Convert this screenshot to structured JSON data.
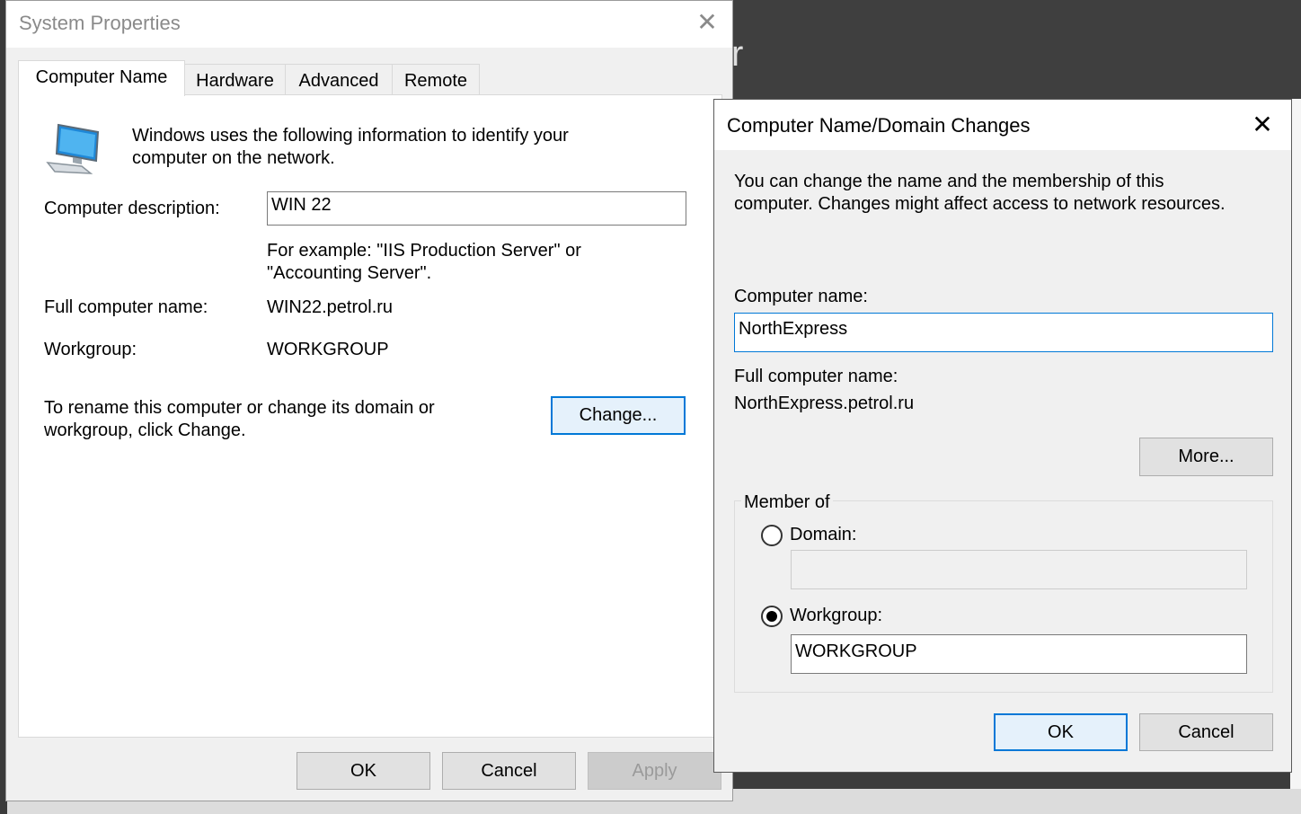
{
  "system_properties": {
    "title": "System Properties",
    "tabs": [
      {
        "label": "Computer Name",
        "active": true
      },
      {
        "label": "Hardware"
      },
      {
        "label": "Advanced"
      },
      {
        "label": "Remote"
      }
    ],
    "intro_line1": "Windows uses the following information to identify your",
    "intro_line2": "computer on the network.",
    "description_label": "Computer description:",
    "description_value": "WIN 22",
    "example_line1": "For example: \"IIS Production Server\" or",
    "example_line2": "\"Accounting Server\".",
    "full_name_label": "Full computer name:",
    "full_name_value": "WIN22.petrol.ru",
    "workgroup_label": "Workgroup:",
    "workgroup_value": "WORKGROUP",
    "rename_line1": "To rename this computer or change its domain or",
    "rename_line2": "workgroup, click Change.",
    "change_button": "Change...",
    "ok_button": "OK",
    "cancel_button": "Cancel",
    "apply_button": "Apply"
  },
  "domain_changes": {
    "title": "Computer Name/Domain Changes",
    "intro_line1": "You can change the name and the membership of this",
    "intro_line2": "computer. Changes might affect access to network resources.",
    "computer_name_label": "Computer name:",
    "computer_name_value": "NorthExpress",
    "full_name_label": "Full computer name:",
    "full_name_value": "NorthExpress.petrol.ru",
    "more_button": "More...",
    "member_of_label": "Member of",
    "domain_label": "Domain:",
    "domain_value": "",
    "domain_selected": false,
    "workgroup_label": "Workgroup:",
    "workgroup_value": "WORKGROUP",
    "workgroup_selected": true,
    "ok_button": "OK",
    "cancel_button": "Cancel"
  },
  "background": {
    "letter": "r"
  },
  "colors": {
    "accent": "#0078d7",
    "dialog_bg": "#f0f0f0",
    "panel_bg": "#ffffff"
  },
  "icons": {
    "computer": "computer-monitor-icon",
    "close": "close-icon"
  }
}
